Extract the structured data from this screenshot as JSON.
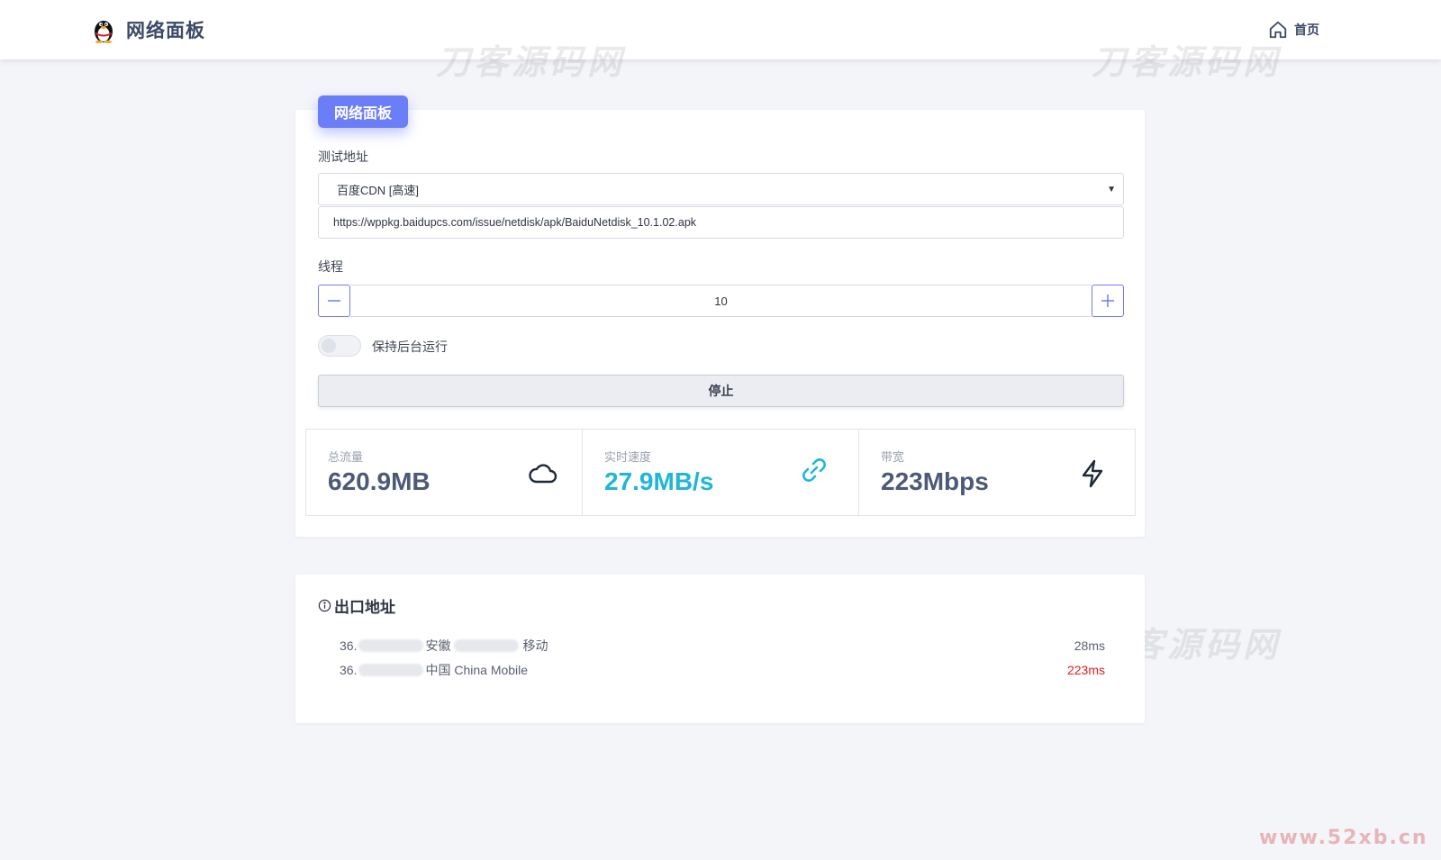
{
  "header": {
    "app_title": "网络面板",
    "logo_icon": "penguin-icon",
    "nav_home_label": "首页",
    "nav_home_icon": "home-icon"
  },
  "watermarks": {
    "text": "刀客源码网",
    "site": "www.52xb.cn"
  },
  "panel": {
    "tag": "网络面板",
    "test_url_label": "测试地址",
    "select_value": "百度CDN [高速]",
    "url_value": "https://wppkg.baidupcs.com/issue/netdisk/apk/BaiduNetdisk_10.1.02.apk",
    "threads_label": "线程",
    "threads_value": "10",
    "minus_symbol": "—",
    "plus_symbol": "+",
    "keep_running_label": "保持后台运行",
    "keep_running_on": false,
    "stop_label": "停止"
  },
  "stats": [
    {
      "label": "总流量",
      "value": "620.9MB",
      "icon": "cloud-icon"
    },
    {
      "label": "实时速度",
      "value": "27.9MB/s",
      "icon": "link-icon"
    },
    {
      "label": "带宽",
      "value": "223Mbps",
      "icon": "lightning-icon"
    }
  ],
  "exit": {
    "title": "出口地址",
    "rows": [
      {
        "ip_prefix": "36.",
        "region": "安徽",
        "isp": "移动",
        "latency": "28ms"
      },
      {
        "ip_prefix": "36.",
        "region": "中国 China Mobile",
        "isp": "",
        "latency": "223ms"
      }
    ]
  },
  "colors": {
    "accent": "#6c7ef7",
    "speed": "#1fb6d8",
    "warn": "#e02020",
    "background": "#f4f5f9"
  }
}
